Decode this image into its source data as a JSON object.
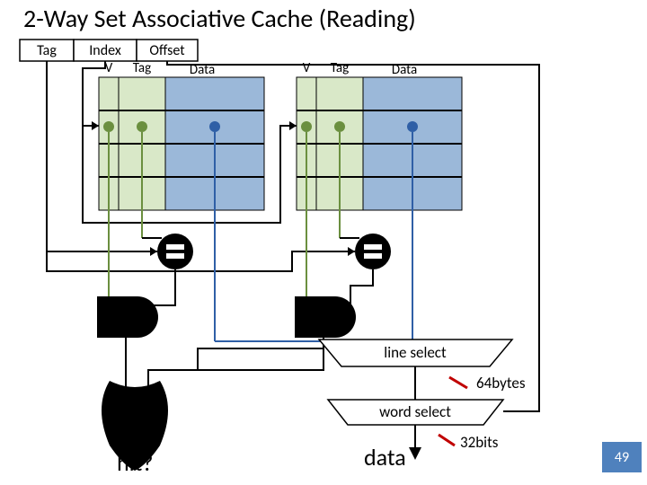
{
  "title": "2-Way Set Associative Cache (Reading)",
  "address_fields": {
    "tag": "Tag",
    "index": "Index",
    "offset": "Offset"
  },
  "way_headers": {
    "valid": "V",
    "tag": "Tag",
    "data": "Data"
  },
  "mux_line_select_label": "line select",
  "mux_word_select_label": "word select",
  "wire_line_bits": "64bytes",
  "wire_word_bits": "32bits",
  "output_hit": "hit?",
  "output_data": "data",
  "slide_number": "49",
  "chart_data": {
    "type": "diagram",
    "topic": "2-way set-associative cache read path",
    "address_split": [
      "Tag",
      "Index",
      "Offset"
    ],
    "ways": 2,
    "per_way_columns": [
      "V",
      "Tag",
      "Data"
    ],
    "sets_drawn": 4,
    "comparators": 2,
    "and_gates": 2,
    "combine_hit": "OR",
    "line_mux_output_width": "64bytes",
    "word_mux_output_width": "32bits",
    "outputs": [
      "hit?",
      "data"
    ]
  }
}
